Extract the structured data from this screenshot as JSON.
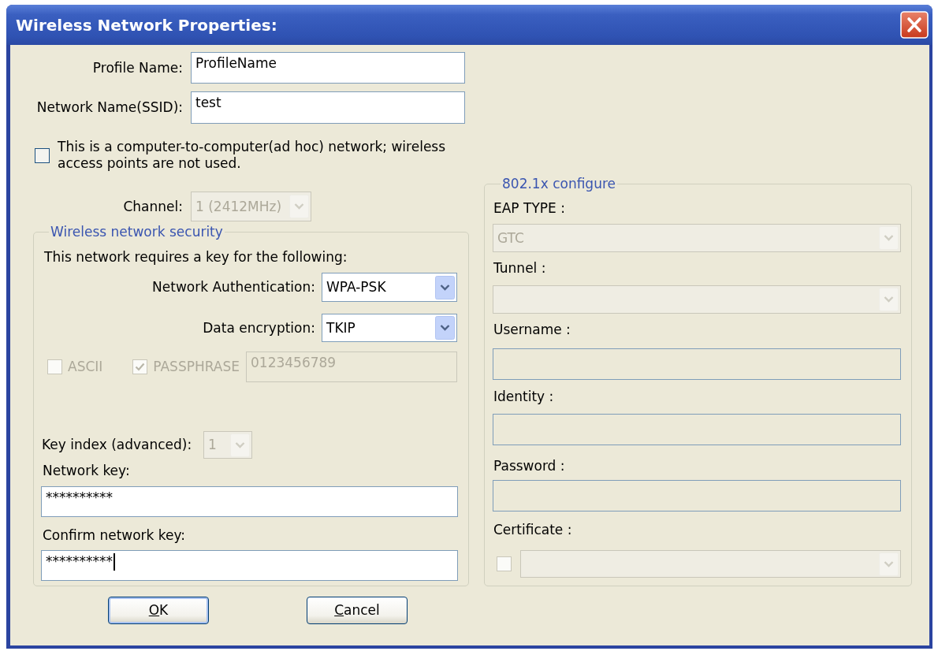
{
  "window": {
    "title": "Wireless Network Properties:"
  },
  "profile": [
    {
      "label": "Profile Name:",
      "value": "ProfileName"
    },
    {
      "label": "Network Name(SSID):",
      "value": "test"
    }
  ],
  "ad_hoc": {
    "label": "This is a computer-to-computer(ad hoc) network; wireless access points are not used.",
    "checked": false
  },
  "channel": {
    "label": "Channel:",
    "value": "1 (2412MHz)",
    "disabled": true
  },
  "security": {
    "title": "Wireless network security",
    "intro": "This network requires a key for the following:",
    "selects": [
      {
        "label": "Network Authentication:",
        "value": "WPA-PSK",
        "disabled": false
      },
      {
        "label": "Data encryption:",
        "value": "TKIP",
        "disabled": false
      }
    ],
    "key_format": [
      {
        "label": "ASCII",
        "checked": false,
        "disabled": true
      },
      {
        "label": "PASSPHRASE",
        "checked": true,
        "disabled": true
      }
    ],
    "passphrase": {
      "value": "0123456789",
      "disabled": true
    },
    "key_index": {
      "label": "Key index (advanced):",
      "value": "1",
      "disabled": true
    },
    "keys": [
      {
        "label": "Network key:",
        "value": "**********",
        "focused": false
      },
      {
        "label": "Confirm network key:",
        "value": "**********",
        "focused": true
      }
    ]
  },
  "eap": {
    "title": "802.1x configure",
    "rows": [
      {
        "kind": "select",
        "label": "EAP TYPE :",
        "value": "GTC",
        "disabled": true
      },
      {
        "kind": "select",
        "label": "Tunnel :",
        "disabled": true
      },
      {
        "kind": "text",
        "label": "Username :",
        "disabled": true
      },
      {
        "kind": "text",
        "label": "Identity :",
        "disabled": true
      },
      {
        "kind": "text",
        "label": "Password :",
        "disabled": true
      },
      {
        "kind": "certificate",
        "label": "Certificate :",
        "checked": false,
        "disabled": true
      }
    ]
  },
  "buttons": [
    {
      "label": "OK",
      "default": true
    },
    {
      "label": "Cancel",
      "default": false
    }
  ]
}
